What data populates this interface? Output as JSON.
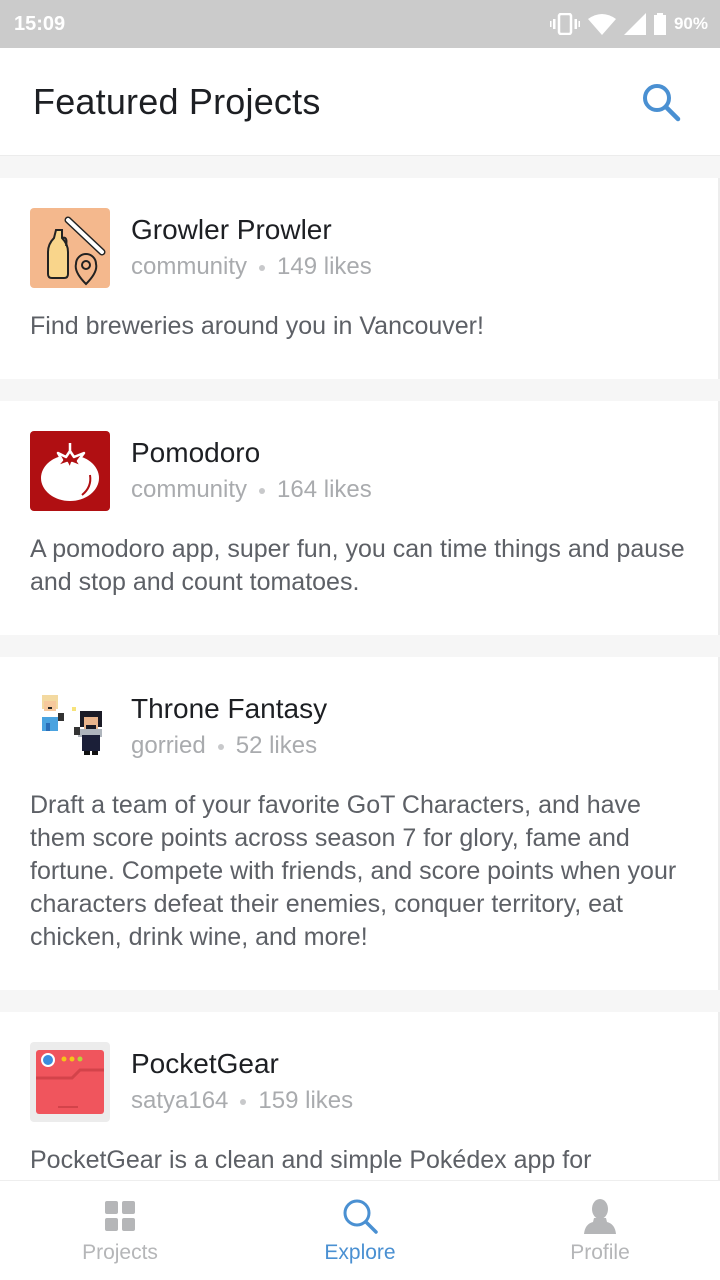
{
  "status_bar": {
    "time": "15:09",
    "battery": "90%"
  },
  "header": {
    "title": "Featured Projects",
    "search_icon": "search-icon"
  },
  "colors": {
    "accent": "#4a90d2",
    "inactive": "#b5b6b8"
  },
  "projects": [
    {
      "title": "Growler Prowler",
      "author": "community",
      "likes": "149 likes",
      "description": "Find breweries around you in Vancouver!",
      "icon": "growler-icon"
    },
    {
      "title": "Pomodoro",
      "author": "community",
      "likes": "164 likes",
      "description": "A pomodoro app, super fun, you can time things and pause and stop and count tomatoes.",
      "icon": "tomato-icon"
    },
    {
      "title": "Throne Fantasy",
      "author": "gorried",
      "likes": "52 likes",
      "description": "Draft a team of your favorite GoT Characters, and have them score points across season 7 for glory, fame and fortune. Compete with friends, and score points when your characters defeat their enemies, conquer territory, eat chicken, drink wine, and more!",
      "icon": "pixel-characters-icon"
    },
    {
      "title": "PocketGear",
      "author": "satya164",
      "likes": "159 likes",
      "description": "PocketGear is a clean and simple Pokédex app for",
      "icon": "pokedex-icon"
    }
  ],
  "tabs": [
    {
      "label": "Projects",
      "icon": "grid-icon",
      "active": false
    },
    {
      "label": "Explore",
      "icon": "search-icon",
      "active": true
    },
    {
      "label": "Profile",
      "icon": "person-icon",
      "active": false
    }
  ]
}
